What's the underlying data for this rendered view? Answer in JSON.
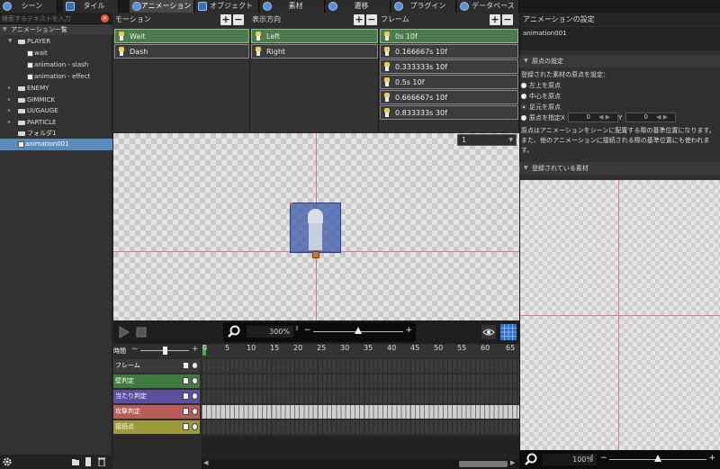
{
  "tabs": [
    {
      "label": "シーン",
      "icon": "scene-icon"
    },
    {
      "label": "タイル",
      "icon": "tile-icon"
    },
    {
      "label": "アニメーション",
      "icon": "animation-icon",
      "active": true
    },
    {
      "label": "オブジェクト",
      "icon": "object-icon"
    },
    {
      "label": "素材",
      "icon": "material-icon"
    },
    {
      "label": "遷移",
      "icon": "transition-icon"
    },
    {
      "label": "プラグイン",
      "icon": "plugin-icon"
    },
    {
      "label": "データベース",
      "icon": "database-icon"
    }
  ],
  "left_panel": {
    "search_placeholder": "検索するテキストを入力",
    "list_title": "アニメーション一覧",
    "tree": [
      {
        "label": "PLAYER",
        "type": "folder",
        "level": 1,
        "expanded": true
      },
      {
        "label": "wait",
        "type": "animation",
        "level": 2
      },
      {
        "label": "animation - slash",
        "type": "animation",
        "level": 2
      },
      {
        "label": "animation - effect",
        "type": "animation",
        "level": 2
      },
      {
        "label": "ENEMY",
        "type": "folder",
        "level": 1
      },
      {
        "label": "GIMMICK",
        "type": "folder",
        "level": 1
      },
      {
        "label": "UI/GAUGE",
        "type": "folder",
        "level": 1
      },
      {
        "label": "PARTICLE",
        "type": "folder",
        "level": 1
      },
      {
        "label": "フォルダ1",
        "type": "folder",
        "level": 1
      },
      {
        "label": "animation001",
        "type": "animation",
        "level": 1,
        "selected": true
      }
    ]
  },
  "motion_column": {
    "title": "モーション",
    "items": [
      {
        "label": "Wait",
        "selected": true
      },
      {
        "label": "Dash",
        "selected": false
      }
    ]
  },
  "direction_column": {
    "title": "表示方向",
    "items": [
      {
        "label": "Left",
        "selected": true
      },
      {
        "label": "Right",
        "selected": false
      }
    ]
  },
  "frame_column": {
    "title": "フレーム",
    "items": [
      "0s 10f",
      "0.166667s 10f",
      "0.333333s 10f",
      "0.5s 10f",
      "0.666667s 10f",
      "0.833333s 30f"
    ],
    "selected_index": 0
  },
  "canvas": {
    "frame_select": "1"
  },
  "transport": {
    "zoom": "300%",
    "zoom_level": 0.5
  },
  "timeline": {
    "time_label": "時間",
    "ruler": [
      "0",
      "5",
      "10",
      "15",
      "20",
      "25",
      "30",
      "35",
      "40",
      "45",
      "50",
      "55",
      "60",
      "65"
    ],
    "tracks": [
      {
        "label": "フレーム",
        "color": "#3b3b3b"
      },
      {
        "label": "壁判定",
        "color": "#3f7a3f"
      },
      {
        "label": "当たり判定",
        "color": "#5d4f9e"
      },
      {
        "label": "攻撃判定",
        "color": "#b85b5b"
      },
      {
        "label": "接続点",
        "color": "#9c9a3c"
      }
    ]
  },
  "right_panel": {
    "title": "アニメーションの設定",
    "name_value": "animation001",
    "origin_section": "原点の設定",
    "origin_desc": "登録された素材の原点を設定：",
    "origin_options": [
      {
        "label": "左上を原点",
        "checked": false
      },
      {
        "label": "中心を原点",
        "checked": false
      },
      {
        "label": "足元を原点",
        "checked": true
      },
      {
        "label": "原点を指定",
        "checked": false
      }
    ],
    "x_label": "X",
    "x_value": "0",
    "y_label": "Y",
    "y_value": "0",
    "help_text": "原点はアニメーションをシーンに配置する際の基準位置になります。また、他のアニメーションに接続される際の基準位置にも使われます。",
    "registered_section": "登録されている素材",
    "zoom": "100%",
    "zoom_level": 0.5
  }
}
